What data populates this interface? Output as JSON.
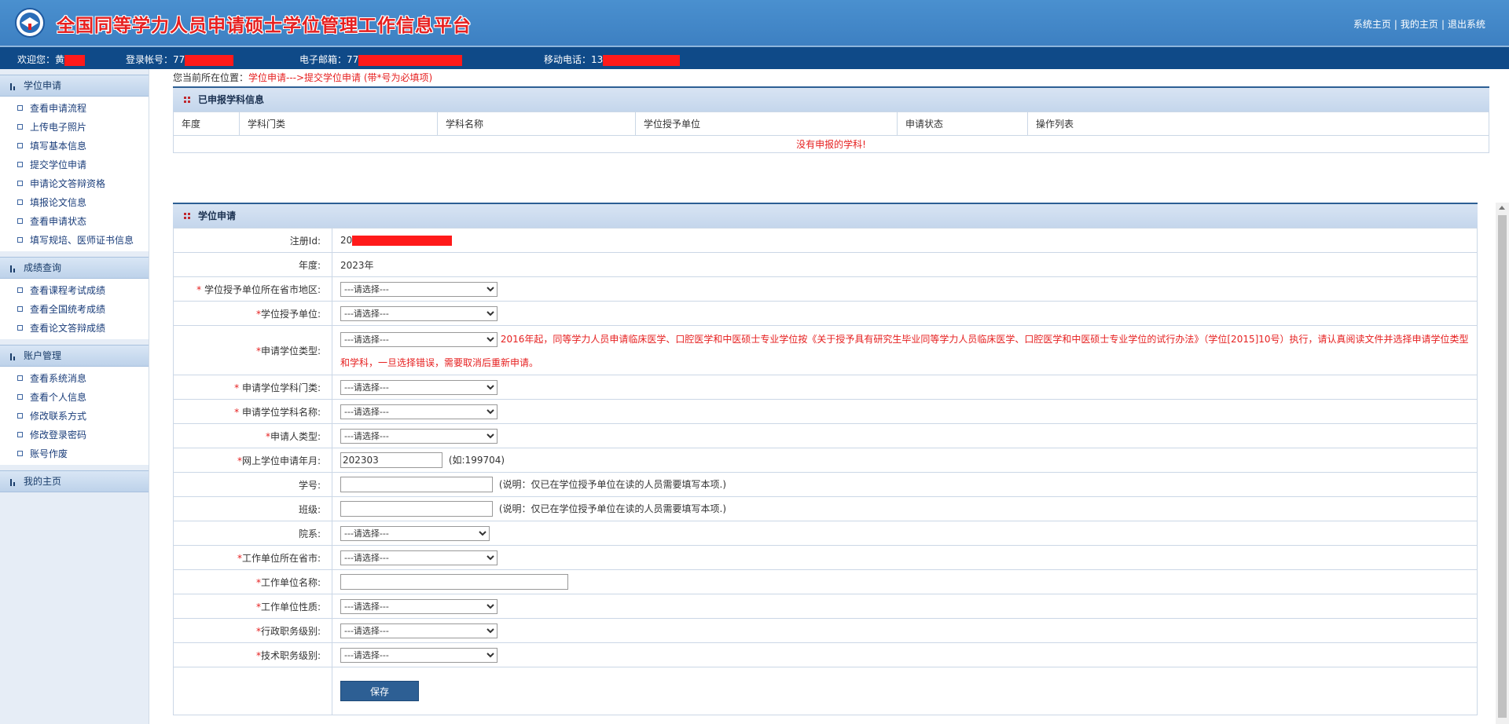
{
  "header": {
    "title": "全国同等学力人员申请硕士学位管理工作信息平台",
    "links": [
      "系统主页",
      "我的主页",
      "退出系统"
    ],
    "separator": "|"
  },
  "infobar": {
    "welcome_label": "欢迎您：",
    "welcome_value": "黄",
    "account_label": "登录帐号：",
    "account_value": "77",
    "email_label": "电子邮箱：",
    "email_value": "77",
    "phone_label": "移动电话：",
    "phone_value": "13"
  },
  "sidebar": {
    "groups": [
      {
        "title": "学位申请",
        "items": [
          "查看申请流程",
          "上传电子照片",
          "填写基本信息",
          "提交学位申请",
          "申请论文答辩资格",
          "填报论文信息",
          "查看申请状态",
          "填写规培、医师证书信息"
        ]
      },
      {
        "title": "成绩查询",
        "items": [
          "查看课程考试成绩",
          "查看全国统考成绩",
          "查看论文答辩成绩"
        ]
      },
      {
        "title": "账户管理",
        "items": [
          "查看系统消息",
          "查看个人信息",
          "修改联系方式",
          "修改登录密码",
          "账号作废"
        ]
      },
      {
        "title": "我的主页",
        "items": []
      }
    ]
  },
  "breadcrumb": {
    "prefix": "您当前所在位置：",
    "path": "学位申请--->提交学位申请 (带*号为必填项)"
  },
  "subject_panel": {
    "title": "已申报学科信息",
    "columns": [
      "年度",
      "学科门类",
      "学科名称",
      "学位授予单位",
      "申请状态",
      "操作列表"
    ],
    "empty_message": "没有申报的学科!"
  },
  "form": {
    "title": "学位申请",
    "select_placeholder": "---请选择---",
    "fields": {
      "reg_id_label": "注册Id:",
      "reg_id_value": "20",
      "year_label": "年度:",
      "year_value": "2023年",
      "region_label": "学位授予单位所在省市地区:",
      "unit_label": "学位授予单位:",
      "degree_type_label": "申请学位类型:",
      "degree_type_note": "2016年起，同等学力人员申请临床医学、口腔医学和中医硕士专业学位按《关于授予具有研究生毕业同等学力人员临床医学、口腔医学和中医硕士专业学位的试行办法》（学位[2015]10号）执行，请认真阅读文件并选择申请学位类型和学科，一旦选择错误，需要取消后重新申请。",
      "category_label": "申请学位学科门类:",
      "subject_label": "申请学位学科名称:",
      "applicant_type_label": "申请人类型:",
      "apply_month_label": "网上学位申请年月:",
      "apply_month_value": "202303",
      "apply_month_hint": "(如:199704)",
      "student_no_label": "学号:",
      "student_no_hint": "(说明：仅已在学位授予单位在读的人员需要填写本项.)",
      "class_label": "班级:",
      "class_hint": "(说明：仅已在学位授予单位在读的人员需要填写本项.)",
      "department_label": "院系:",
      "work_city_label": "工作单位所在省市:",
      "work_unit_label": "工作单位名称:",
      "work_nature_label": "工作单位性质:",
      "admin_level_label": "行政职务级别:",
      "tech_level_label": "技术职务级别:",
      "required_mark": "*"
    },
    "save_label": "保存"
  },
  "colors": {
    "header_bg": "#4a90cf",
    "infobar_bg": "#0f4a88",
    "accent_red": "#e62020",
    "button_bg": "#2d5f94"
  }
}
